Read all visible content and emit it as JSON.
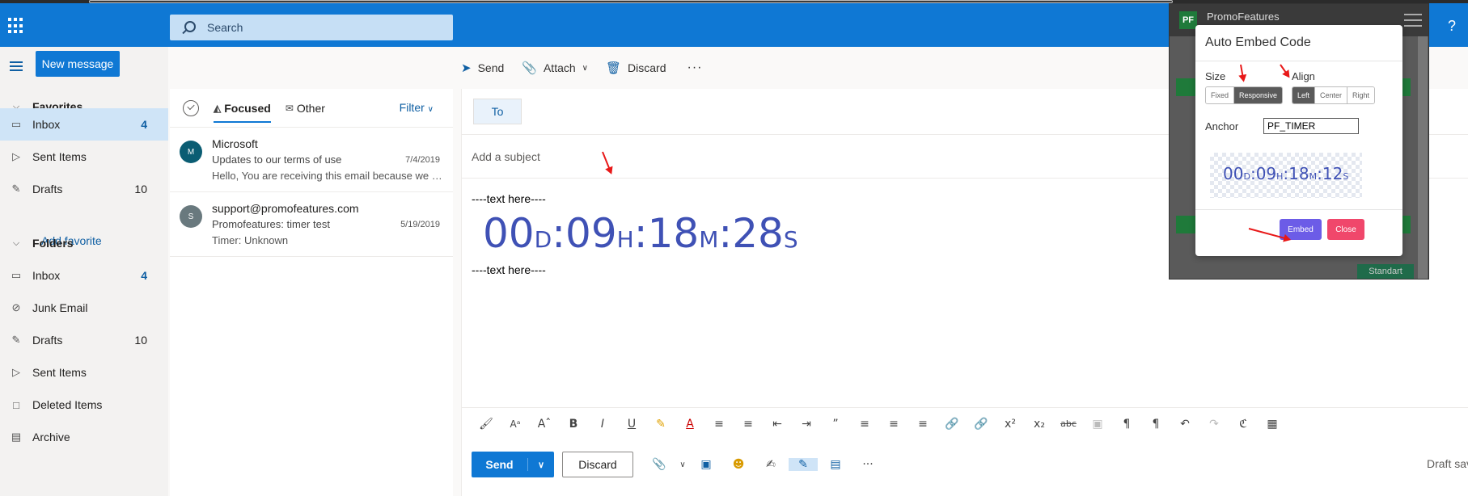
{
  "header": {
    "search_placeholder": "Search",
    "help_label": "?"
  },
  "leftnav": {
    "new_message": "New message",
    "favorites_label": "Favorites",
    "favorites": [
      {
        "label": "Inbox",
        "count": "4",
        "icon": "inbox-icon"
      },
      {
        "label": "Sent Items",
        "count": "",
        "icon": "send-icon"
      },
      {
        "label": "Drafts",
        "count": "10",
        "icon": "pencil-icon"
      }
    ],
    "add_favorite": "Add favorite",
    "folders_label": "Folders",
    "folders": [
      {
        "label": "Inbox",
        "count": "4",
        "icon": "inbox-icon"
      },
      {
        "label": "Junk Email",
        "count": "",
        "icon": "block-icon"
      },
      {
        "label": "Drafts",
        "count": "10",
        "icon": "pencil-icon"
      },
      {
        "label": "Sent Items",
        "count": "",
        "icon": "send-icon"
      },
      {
        "label": "Deleted Items",
        "count": "",
        "icon": "trash-icon"
      },
      {
        "label": "Archive",
        "count": "",
        "icon": "archive-icon"
      }
    ]
  },
  "msglist": {
    "tabs": [
      {
        "label": "Focused"
      },
      {
        "label": "Other"
      }
    ],
    "filter_label": "Filter",
    "messages": [
      {
        "initial": "M",
        "avatar_color": "#0b5d73",
        "from": "Microsoft",
        "subject": "Updates to our terms of use",
        "date": "7/4/2019",
        "preview": "Hello, You are receiving this email because we are updating"
      },
      {
        "initial": "S",
        "avatar_color": "#69797e",
        "from": "support@promofeatures.com",
        "subject": "Promofeatures: timer test",
        "date": "5/19/2019",
        "preview": "Timer: Unknown"
      }
    ]
  },
  "compose_toolbar": {
    "send": "Send",
    "attach": "Attach",
    "discard": "Discard",
    "more": "···"
  },
  "compose": {
    "to_label": "To",
    "subject_placeholder": "Add a subject",
    "line1": "----text here----",
    "line2": "----text here----",
    "timer": {
      "days": "00",
      "d": "D",
      "hours": "09",
      "h": "H",
      "minutes": "18",
      "m": "M",
      "seconds": "28",
      "s": "S",
      "sep": ":"
    },
    "send_label": "Send",
    "discard_label": "Discard",
    "more": "···",
    "draft_saved": "Draft sav"
  },
  "promofeatures": {
    "logo": "PF",
    "title": "PromoFeatures",
    "standard": "Standart"
  },
  "dialog": {
    "title": "Auto Embed Code",
    "size_label": "Size",
    "size_options": [
      "Fixed",
      "Responsive"
    ],
    "size_selected": "Responsive",
    "align_label": "Align",
    "align_options": [
      "Left",
      "Center",
      "Right"
    ],
    "align_selected": "Left",
    "anchor_label": "Anchor",
    "anchor_value": "PF_TIMER",
    "preview_timer": {
      "days": "00",
      "d": "D",
      "hours": "09",
      "h": "H",
      "minutes": "18",
      "m": "M",
      "seconds": "12",
      "s": "S",
      "sep": ":"
    },
    "embed_label": "Embed",
    "close_label": "Close"
  },
  "colors": {
    "brand": "#0f78d4",
    "timer": "#3f51b5",
    "embed": "#6c5ce7",
    "close": "#f0476b",
    "annotation": "#e81818"
  }
}
